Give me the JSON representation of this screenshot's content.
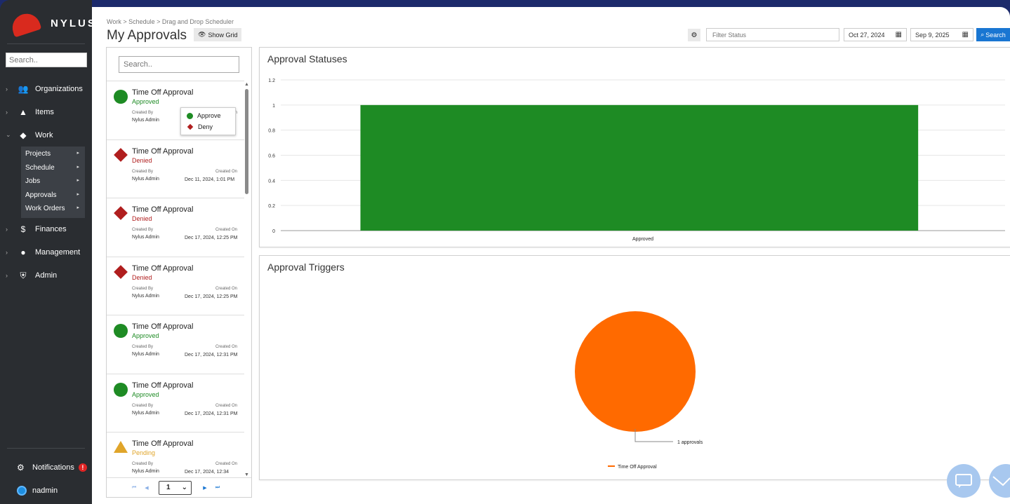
{
  "brand": {
    "name": "NYLUS"
  },
  "sidebar": {
    "search_placeholder": "Search..",
    "items": [
      {
        "label": "Organizations",
        "icon": "users-icon"
      },
      {
        "label": "Items",
        "icon": "box-hand-icon"
      },
      {
        "label": "Work",
        "icon": "handshake-icon",
        "expanded": true
      },
      {
        "label": "Finances",
        "icon": "dollar-icon"
      },
      {
        "label": "Management",
        "icon": "user-icon"
      },
      {
        "label": "Admin",
        "icon": "shield-icon"
      }
    ],
    "work_sub": [
      "Projects",
      "Schedule",
      "Jobs",
      "Approvals",
      "Work Orders"
    ],
    "notifications_label": "Notifications",
    "notifications_badge": "!",
    "user_label": "nadmin"
  },
  "header": {
    "breadcrumb": "Work > Schedule > Drag and Drop Scheduler",
    "title": "My Approvals",
    "show_grid_label": "Show Grid",
    "filter_placeholder": "Filter Status",
    "date_from": "Oct 27, 2024",
    "date_to": "Sep 9, 2025",
    "search_label": "Search"
  },
  "list": {
    "search_placeholder": "Search..",
    "created_by_label": "Created By",
    "created_on_label": "Created On",
    "items": [
      {
        "title": "Time Off Approval",
        "status": "Approved",
        "kind": "approved",
        "created_by": "Nylus Admin",
        "created_on": ""
      },
      {
        "title": "Time Off Approval",
        "status": "Denied",
        "kind": "denied",
        "created_by": "Nylus Admin",
        "created_on": "Dec 11, 2024, 1:01 PM"
      },
      {
        "title": "Time Off Approval",
        "status": "Denied",
        "kind": "denied",
        "created_by": "Nylus Admin",
        "created_on": "Dec 17, 2024, 12:25 PM"
      },
      {
        "title": "Time Off Approval",
        "status": "Denied",
        "kind": "denied",
        "created_by": "Nylus Admin",
        "created_on": "Dec 17, 2024, 12:25 PM"
      },
      {
        "title": "Time Off Approval",
        "status": "Approved",
        "kind": "approved",
        "created_by": "Nylus Admin",
        "created_on": "Dec 17, 2024, 12:31 PM"
      },
      {
        "title": "Time Off Approval",
        "status": "Approved",
        "kind": "approved",
        "created_by": "Nylus Admin",
        "created_on": "Dec 17, 2024, 12:31 PM"
      },
      {
        "title": "Time Off Approval",
        "status": "Pending",
        "kind": "pending",
        "created_by": "Nylus Admin",
        "created_on": "Dec 17, 2024, 12:34"
      }
    ],
    "popup": {
      "approve_label": "Approve",
      "deny_label": "Deny"
    },
    "pager": {
      "current_page": "1"
    }
  },
  "colors": {
    "approved": "#1e8b24",
    "denied": "#b01e1e",
    "pending": "#e0a52a",
    "pie": "#ff6a00",
    "primary": "#1976d2"
  },
  "chart_data": [
    {
      "type": "bar",
      "title": "Approval Statuses",
      "categories": [
        "Approved"
      ],
      "values": [
        1
      ],
      "ylim": [
        0,
        1.2
      ],
      "yticks": [
        "0",
        "0.2",
        "0.4",
        "0.6",
        "0.8",
        "1",
        "1.2"
      ],
      "grid": true,
      "color": "#1e8b24"
    },
    {
      "type": "pie",
      "title": "Approval Triggers",
      "categories": [
        "Time Off Approval"
      ],
      "values": [
        1
      ],
      "slice_labels": [
        "1 approvals"
      ],
      "legend": "bottom",
      "color": "#ff6a00"
    }
  ]
}
